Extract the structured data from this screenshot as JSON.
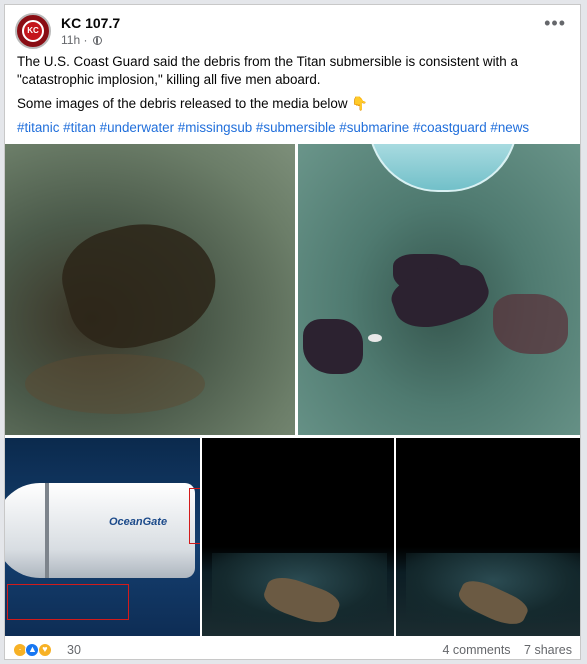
{
  "post": {
    "page_name": "KC 107.7",
    "avatar_text": "KC",
    "time": "11h",
    "more_label": "•••",
    "body_paragraph_1": "The U.S. Coast Guard said the debris from the Titan submersible is consistent with a \"catastrophic implosion,\" killing all five men aboard.",
    "body_paragraph_2": "Some images of the debris released to the media below 👇",
    "hashtags": "#titanic #titan #underwater #missingsub #submersible #submarine #coastguard #news"
  },
  "media": {
    "sub_logo": "OceanGate"
  },
  "footer": {
    "reaction_count": "30",
    "comments": "4 comments",
    "shares": "7 shares"
  },
  "colors": {
    "hashtag": "#216fdb",
    "brand_red": "#c4161c",
    "meta_gray": "#65676b"
  },
  "icons": {
    "reactions": [
      "sad-reaction-icon",
      "like-reaction-icon",
      "care-reaction-icon"
    ]
  }
}
